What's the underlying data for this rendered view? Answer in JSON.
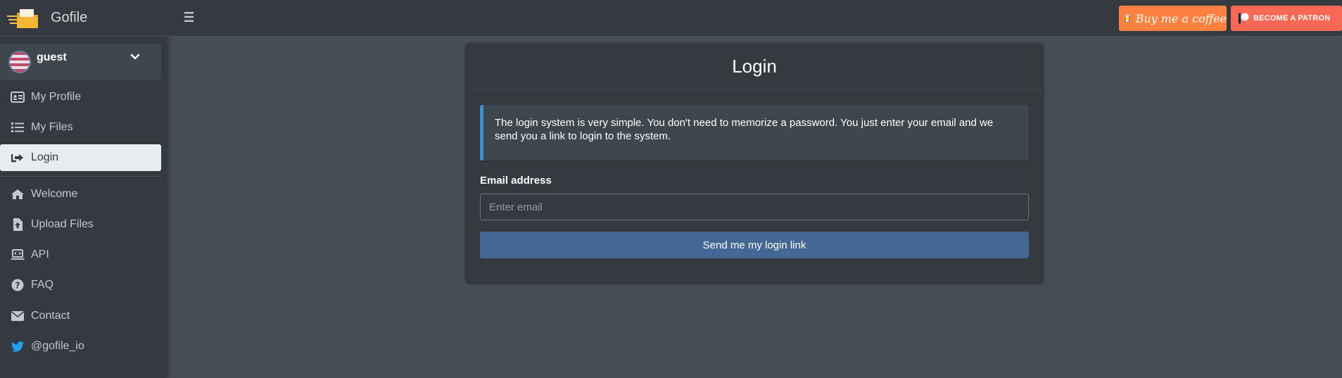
{
  "brand": {
    "name": "Gofile",
    "logo_icon": "gofile-logo-icon"
  },
  "user": {
    "name": "guest",
    "caret_icon": "chevron-down-icon"
  },
  "sidebar": {
    "items": [
      {
        "label": "My Profile",
        "icon": "id-card-icon"
      },
      {
        "label": "My Files",
        "icon": "list-icon"
      },
      {
        "label": "Login",
        "icon": "sign-in-icon",
        "active": true
      },
      {
        "label": "Welcome",
        "icon": "home-icon"
      },
      {
        "label": "Upload Files",
        "icon": "file-upload-icon"
      },
      {
        "label": "API",
        "icon": "laptop-code-icon"
      },
      {
        "label": "FAQ",
        "icon": "question-circle-icon"
      },
      {
        "label": "Contact",
        "icon": "envelope-icon"
      },
      {
        "label": "@gofile_io",
        "icon": "twitter-icon"
      }
    ]
  },
  "topbar": {
    "menu_icon": "hamburger-icon",
    "buy_coffee_label": "Buy me a coffee",
    "patron_label": "BECOME A PATRON"
  },
  "login": {
    "title": "Login",
    "info": "The login system is very simple. You don't need to memorize a password. You just enter your email and we send you a link to login to the system.",
    "email_label": "Email address",
    "email_placeholder": "Enter email",
    "email_value": "",
    "submit_label": "Send me my login link"
  },
  "colors": {
    "sidebar_bg": "#343a40",
    "content_bg": "#454d55",
    "callout_border": "#3f8fcf",
    "primary_button": "#436896",
    "coffee_button": "#ff813f",
    "patron_button": "#f96854"
  }
}
